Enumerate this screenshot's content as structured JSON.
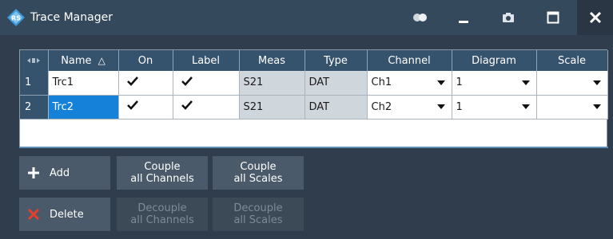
{
  "window": {
    "title": "Trace Manager"
  },
  "titlebar_icons": [
    "toggle-icon",
    "minimize-icon",
    "camera-icon",
    "maximize-icon",
    "close-icon"
  ],
  "table": {
    "corner_icon": "columns-icon",
    "columns": [
      "Name",
      "On",
      "Label",
      "Meas",
      "Type",
      "Channel",
      "Diagram",
      "Scale"
    ],
    "sort_indicator": "△",
    "rows": [
      {
        "num": "1",
        "name": "Trc1",
        "on": true,
        "label": true,
        "meas": "S21",
        "type": "DAT",
        "channel": "Ch1",
        "diagram": "1",
        "scale": ""
      },
      {
        "num": "2",
        "name": "Trc2",
        "on": true,
        "label": true,
        "meas": "S21",
        "type": "DAT",
        "channel": "Ch2",
        "diagram": "1",
        "scale": ""
      }
    ],
    "selected_cell": "row 2 name"
  },
  "buttons": {
    "add": "Add",
    "delete": "Delete",
    "couple_channels_1": "Couple",
    "couple_channels_2": "all Channels",
    "couple_scales_1": "Couple",
    "couple_scales_2": "all Scales",
    "decouple_channels_1": "Decouple",
    "decouple_channels_2": "all Channels",
    "decouple_scales_1": "Decouple",
    "decouple_scales_2": "all Scales"
  },
  "colors": {
    "background": "#2f3d4d",
    "titlebar": "#34495c",
    "header": "#36536e",
    "selection": "#1681d8",
    "add_icon": "#ffffff",
    "delete_icon": "#e8402a"
  }
}
